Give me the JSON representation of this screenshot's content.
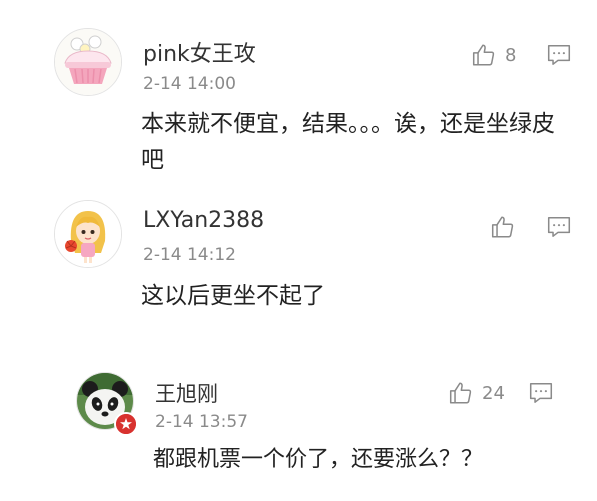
{
  "comments": [
    {
      "username": "pink女王攻",
      "time": "2-14 14:00",
      "text": "本来就不便宜，结果。。。诶，还是坐绿皮吧",
      "likes": "8",
      "avatar_icon": "cupcake-avatar"
    },
    {
      "username": "LXYan2388",
      "time": "2-14 14:12",
      "text": "这以后更坐不起了",
      "likes": "",
      "avatar_icon": "cartoon-girl-avatar"
    },
    {
      "username": "王旭刚",
      "time": "2-14 13:57",
      "text": "都跟机票一个价了，还要涨么？？",
      "likes": "24",
      "avatar_icon": "panda-avatar",
      "badge_icon": "verified-badge-icon"
    }
  ],
  "colors": {
    "username": "#333333",
    "meta": "#8a8a8a",
    "text": "#222222",
    "icon": "#8a8a8a",
    "badge": "#d8322f"
  }
}
